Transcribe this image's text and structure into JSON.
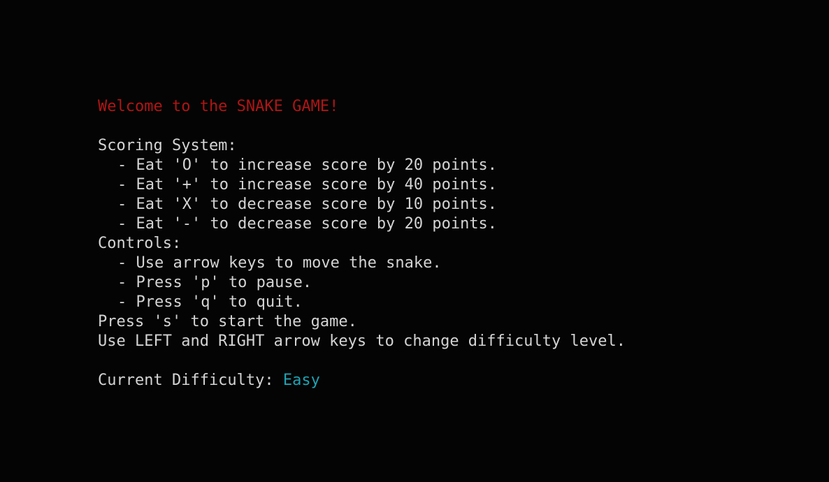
{
  "title": "Welcome to the SNAKE GAME!",
  "scoring": {
    "heading": "Scoring System:",
    "items": [
      "- Eat 'O' to increase score by 20 points.",
      "- Eat '+' to increase score by 40 points.",
      "- Eat 'X' to decrease score by 10 points.",
      "- Eat '-' to decrease score by 20 points."
    ]
  },
  "controls": {
    "heading": "Controls:",
    "items": [
      "- Use arrow keys to move the snake.",
      "- Press 'p' to pause.",
      "- Press 'q' to quit."
    ]
  },
  "start_prompt": "Press 's' to start the game.",
  "difficulty_prompt": "Use LEFT and RIGHT arrow keys to change difficulty level.",
  "difficulty": {
    "label": "Current Difficulty: ",
    "value": "Easy"
  },
  "colors": {
    "background": "#040404",
    "text": "#d4d4d4",
    "title": "#b01515",
    "difficulty_value": "#1fa2b3"
  }
}
